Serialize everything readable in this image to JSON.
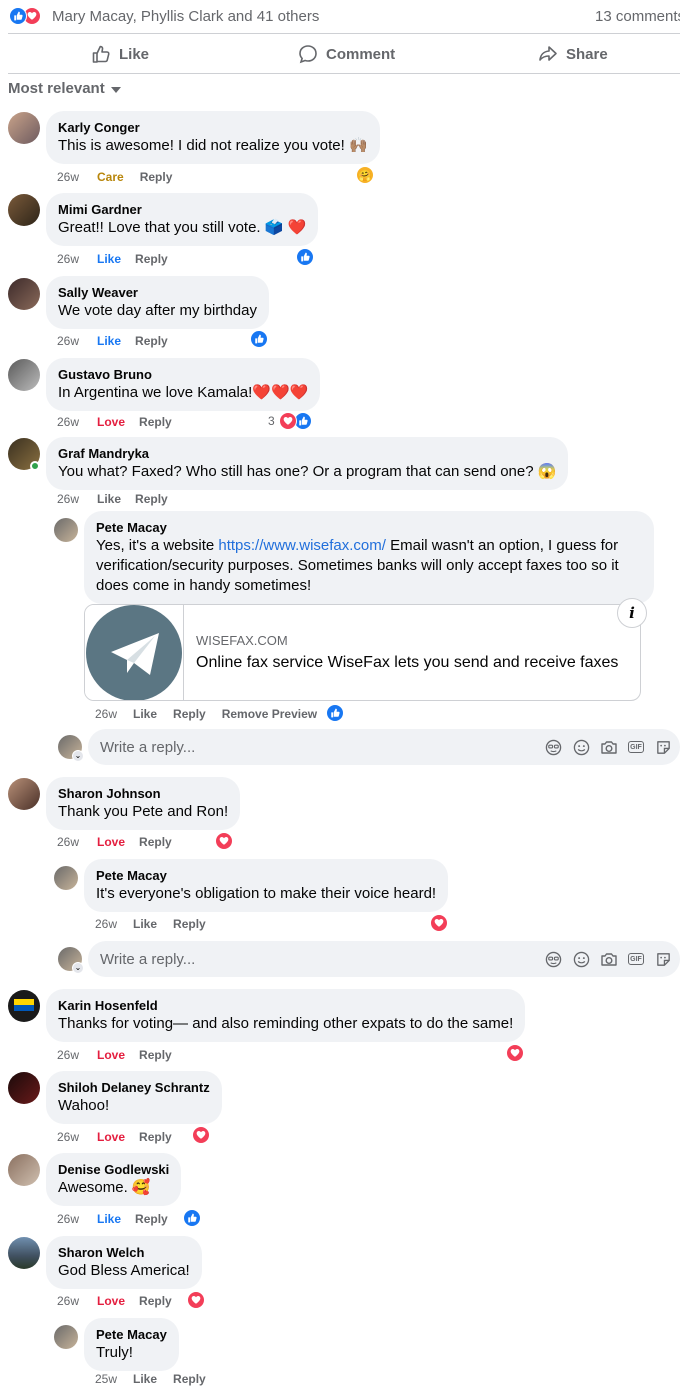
{
  "header": {
    "reactors": "Mary Macay, Phyllis Clark and 41 others",
    "comment_count": "13 comments",
    "actions": {
      "like": "Like",
      "comment": "Comment",
      "share": "Share"
    },
    "sort_label": "Most relevant"
  },
  "comments": [
    {
      "author": "Karly Conger",
      "text": "This is awesome! I did not realize you vote! 🙌🏽",
      "time": "26w",
      "reaction": "Care",
      "reply": "Reply"
    },
    {
      "author": "Mimi Gardner",
      "text": "Great!! Love that you still vote. 🗳️ ❤️",
      "time": "26w",
      "reaction": "Like",
      "reply": "Reply"
    },
    {
      "author": "Sally Weaver",
      "text": "We vote day after my birthday",
      "time": "26w",
      "reaction": "Like",
      "reply": "Reply"
    },
    {
      "author": "Gustavo Bruno",
      "text": "In Argentina we love Kamala!❤️❤️❤️",
      "time": "26w",
      "reaction": "Love",
      "reply": "Reply",
      "reaction_count": "3"
    },
    {
      "author": "Graf Mandryka",
      "text": "You what? Faxed? Who still has one? Or a program that can send one? 😱",
      "time": "26w",
      "reaction": "Like",
      "reply": "Reply"
    },
    {
      "author": "Sharon Johnson",
      "text": "Thank you Pete and Ron!",
      "time": "26w",
      "reaction": "Love",
      "reply": "Reply"
    },
    {
      "author": "Karin Hosenfeld",
      "text": "Thanks for voting— and also reminding other expats to do the same!",
      "time": "26w",
      "reaction": "Love",
      "reply": "Reply"
    },
    {
      "author": "Shiloh Delaney Schrantz",
      "text": "Wahoo!",
      "time": "26w",
      "reaction": "Love",
      "reply": "Reply"
    },
    {
      "author": "Denise Godlewski",
      "text": "Awesome. 🥰",
      "time": "26w",
      "reaction": "Like",
      "reply": "Reply"
    },
    {
      "author": "Sharon Welch",
      "text": "God Bless America!",
      "time": "26w",
      "reaction": "Love",
      "reply": "Reply"
    }
  ],
  "replies": [
    {
      "author": "Pete Macay",
      "text_before": "Yes, it's a website ",
      "link": "https://www.wisefax.com/",
      "text_after": " Email wasn't an option, I guess for verification/security purposes. Sometimes banks will only accept faxes too so it does come in handy sometimes!",
      "time": "26w",
      "like": "Like",
      "reply": "Reply",
      "remove_preview": "Remove Preview"
    },
    {
      "author": "Pete Macay",
      "text": "It's everyone's obligation to make their voice heard!",
      "time": "26w",
      "like": "Like",
      "reply": "Reply"
    },
    {
      "author": "Pete Macay",
      "text": "Truly!",
      "time": "25w",
      "like": "Like",
      "reply": "Reply"
    }
  ],
  "link_preview": {
    "domain": "WISEFAX.COM",
    "title": "Online fax service WiseFax lets you send and receive faxes",
    "info_icon": "i"
  },
  "reply_box": {
    "placeholder": "Write a reply..."
  },
  "colors": {
    "like": "#1877f2",
    "love": "#e41e3f",
    "care": "#b8860b",
    "bubble": "#f0f2f5",
    "muted": "#65676b"
  }
}
